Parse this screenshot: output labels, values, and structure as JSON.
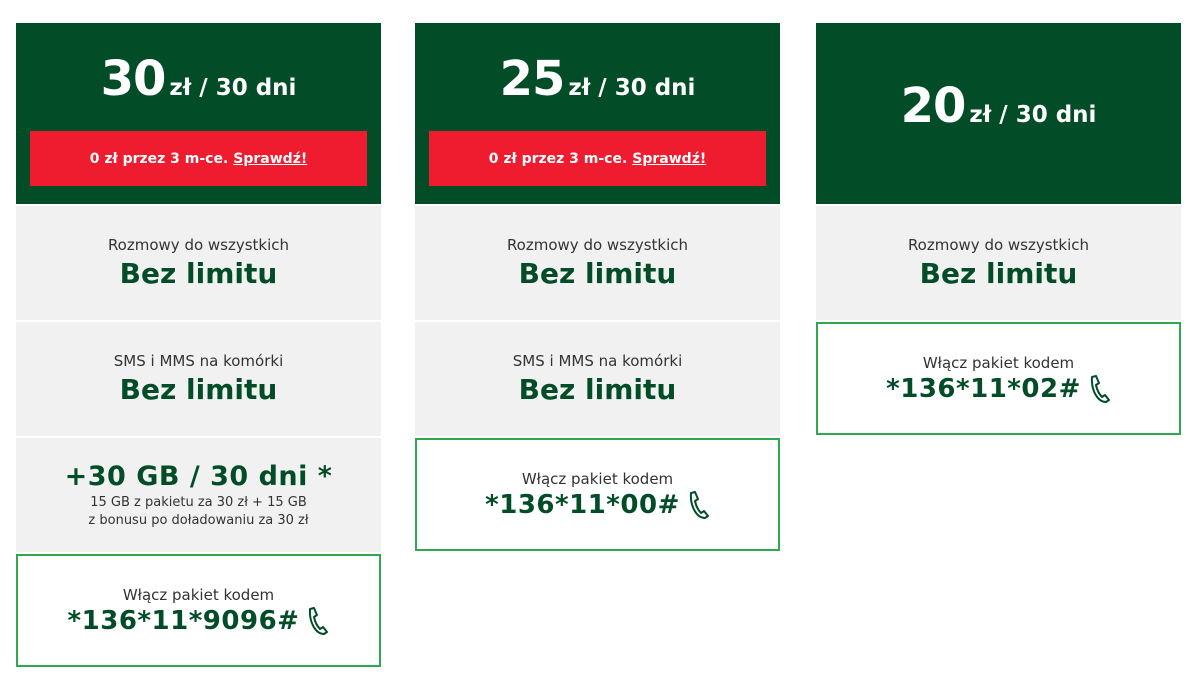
{
  "colors": {
    "header_bg": "#024d27",
    "promo_bg": "#ee1c2e",
    "feature_bg": "#f1f1f1",
    "code_border": "#2fa84f",
    "value_text": "#024d27"
  },
  "plans": [
    {
      "price": "30",
      "period": "zł / 30 dni",
      "promo_text": "0 zł przez 3 m-ce.",
      "promo_link": "Sprawdź!",
      "calls_label": "Rozmowy do wszystkich",
      "calls_value": "Bez limitu",
      "sms_label": "SMS i MMS na komórki",
      "sms_value": "Bez limitu",
      "data_value": "+30 GB / 30 dni *",
      "data_note_1": "15 GB z pakietu za 30 zł + 15 GB",
      "data_note_2": "z bonusu po doładowaniu za 30 zł",
      "code_label": "Włącz pakiet kodem",
      "code": "*136*11*9096#",
      "code_icon": "phone-icon"
    },
    {
      "price": "25",
      "period": "zł / 30 dni",
      "promo_text": "0 zł przez 3 m-ce.",
      "promo_link": "Sprawdź!",
      "calls_label": "Rozmowy do wszystkich",
      "calls_value": "Bez limitu",
      "sms_label": "SMS i MMS na komórki",
      "sms_value": "Bez limitu",
      "code_label": "Włącz pakiet kodem",
      "code": "*136*11*00#",
      "code_icon": "phone-icon"
    },
    {
      "price": "20",
      "period": "zł / 30 dni",
      "calls_label": "Rozmowy do wszystkich",
      "calls_value": "Bez limitu",
      "code_label": "Włącz pakiet kodem",
      "code": "*136*11*02#",
      "code_icon": "phone-icon"
    }
  ]
}
